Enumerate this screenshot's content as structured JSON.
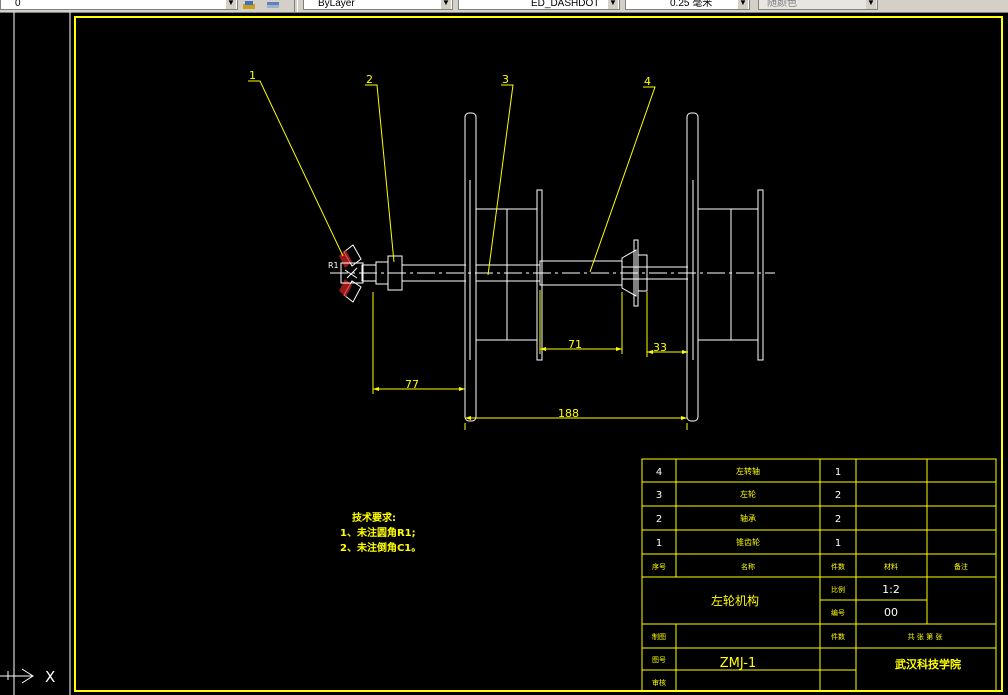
{
  "toolbar": {
    "layer_value": "0",
    "color_value": "ByLayer",
    "linetype_value": "ED_DASHDOT",
    "lineweight_value": "0.25 毫米",
    "plotstyle_value": "随颜色"
  },
  "drawing": {
    "balloons": [
      "1",
      "2",
      "3",
      "4"
    ],
    "fillet_label": "R1",
    "dimensions": {
      "d71": "71",
      "d33": "33",
      "d77": "77",
      "d188": "188"
    },
    "tech_req": {
      "title": "技术要求:",
      "line1": "1、未注圆角R1;",
      "line2": "2、未注倒角C1。"
    }
  },
  "title_block": {
    "parts": [
      {
        "no": "4",
        "name": "左转轴",
        "qty": "1"
      },
      {
        "no": "3",
        "name": "左轮",
        "qty": "2"
      },
      {
        "no": "2",
        "name": "轴承",
        "qty": "2"
      },
      {
        "no": "1",
        "name": "锥齿轮",
        "qty": "1"
      }
    ],
    "header": {
      "no": "序号",
      "name": "名称",
      "qty": "件数",
      "material": "材料",
      "remark": "备注"
    },
    "assembly_name": "左轮机构",
    "scale_label": "比例",
    "scale_value": "1:2",
    "number_label": "编号",
    "number_value": "00",
    "pieces_label": "件数",
    "sheets_text": "共 张 第 张",
    "drawn_label": "制图",
    "drawing_label": "图号",
    "drawing_no": "ZMJ-1",
    "check_label": "审核",
    "school": "武汉科技学院"
  },
  "ucs_label": "X"
}
